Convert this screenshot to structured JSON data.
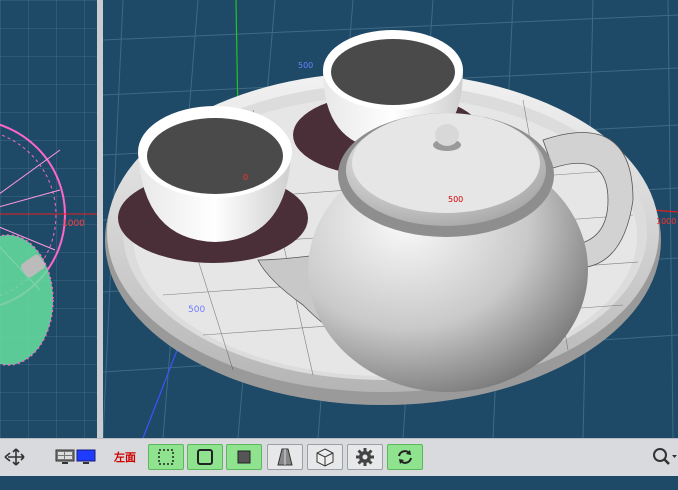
{
  "viewports": {
    "main": {
      "labels": {
        "x_tick": "500",
        "z_tick": "500",
        "y_tick": "500",
        "x_end": "1000",
        "origin": "0"
      }
    },
    "left": {
      "labels": {
        "x_end": "1000"
      }
    }
  },
  "toolbar": {
    "view_label": "左面",
    "buttons": [
      {
        "name": "move-icon",
        "active": false
      },
      {
        "name": "viewport-layout-icon",
        "active": false
      },
      {
        "name": "select-dashed-icon",
        "active": true
      },
      {
        "name": "frame-icon",
        "active": true
      },
      {
        "name": "solid-square-icon",
        "active": true
      },
      {
        "name": "perspective-icon",
        "active": false
      },
      {
        "name": "wireframe-cube-icon",
        "active": false
      },
      {
        "name": "gear-icon",
        "active": false
      },
      {
        "name": "refresh-icon",
        "active": true
      },
      {
        "name": "zoom-icon",
        "active": false
      }
    ]
  },
  "colors": {
    "background": "#1e4a67",
    "grid": "#3e6a86",
    "axis_x": "#e02020",
    "axis_y": "#22c422",
    "axis_z": "#3a55ff",
    "selection": "#ff66cc",
    "toolbar_active": "#8fe38f"
  }
}
